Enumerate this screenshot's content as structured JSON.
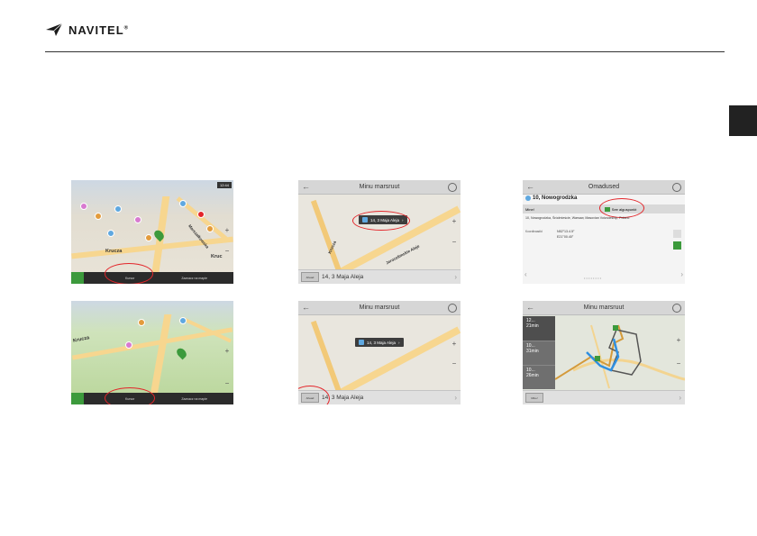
{
  "header": {
    "brand": "NAVITEL",
    "reg": "®"
  },
  "screens": {
    "map1": {
      "street1": "Kruczа",
      "street2": "Marszałkowska",
      "street3": "Kruc",
      "status": "12:44",
      "btn_center": "Kursor",
      "btn_right": "Zaznacz na mapie"
    },
    "route1": {
      "title": "Minu marsruut",
      "callout": "14, 3 Maja Aleja",
      "bottom": "14, 3 Maja Aleja",
      "btn": "Ahead",
      "street": "Krucza",
      "street2": "Jerozolimskie Aleje"
    },
    "info": {
      "title": "Omadused",
      "place": "10, Nowogrodzka",
      "btn_left": "Mine!",
      "btn_green": "See alguspunkt",
      "address": "10, Nowogrodzka, Śródmieście, Warsaw, Masovian Voivodeship, Poland",
      "coords_label": "Koordinaadid",
      "lat": "N52°13.4.5°",
      "lon": "E21°00.40°",
      "dots": "• • • • • • • •"
    },
    "map2": {
      "street1": "Krucza",
      "btn_center": "Kursor",
      "btn_right": "Zaznacz na mapie"
    },
    "route2": {
      "title": "Minu marsruut",
      "callout": "14, 3 Maja Aleja",
      "bottom": "14, 3 Maja Aleja",
      "btn": "Ahead"
    },
    "routes": {
      "title": "Minu marsruut",
      "r1_dist": "12...",
      "r1_time": "21min",
      "r2_dist": "10...",
      "r2_time": "31min",
      "r3_dist": "10...",
      "r3_time": "26min",
      "btn": "Mine!"
    }
  },
  "colors": {
    "highlight": "#e3252a",
    "route_blue": "#2f8fe0",
    "green": "#3c9a3c"
  }
}
